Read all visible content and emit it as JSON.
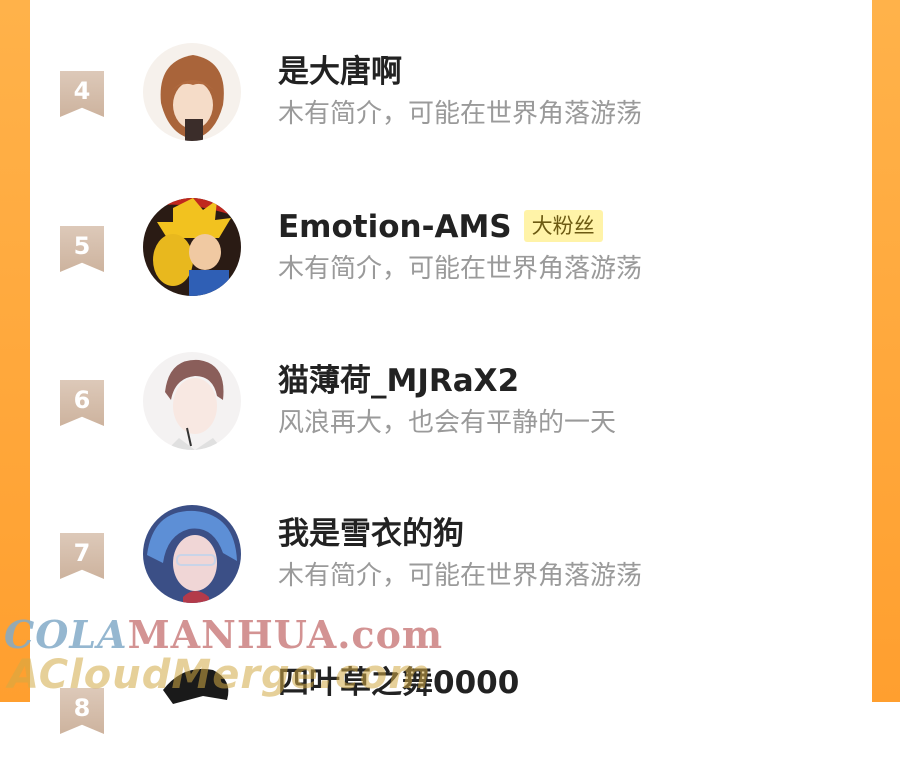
{
  "users": [
    {
      "rank": "4",
      "name": "是大唐啊",
      "badge": "",
      "bio": "木有简介，可能在世界角落游荡"
    },
    {
      "rank": "5",
      "name": "Emotion-AMS",
      "badge": "大粉丝",
      "bio": "木有简介，可能在世界角落游荡"
    },
    {
      "rank": "6",
      "name": "猫薄荷_MJRaX2",
      "badge": "",
      "bio": "风浪再大，也会有平静的一天"
    },
    {
      "rank": "7",
      "name": "我是雪衣的狗",
      "badge": "",
      "bio": "木有简介，可能在世界角落游荡"
    },
    {
      "rank": "8",
      "name": "四叶草之舞0000",
      "badge": "",
      "bio": ""
    }
  ],
  "watermark": {
    "line1_prefix": "COLA",
    "line1_main": "MANHUA.com",
    "line2": "ACloudMerge.com"
  },
  "colors": {
    "side_orange": "#ffa53a",
    "rank_badge": "#d4bca8",
    "fan_badge_bg": "#fff3a8"
  }
}
